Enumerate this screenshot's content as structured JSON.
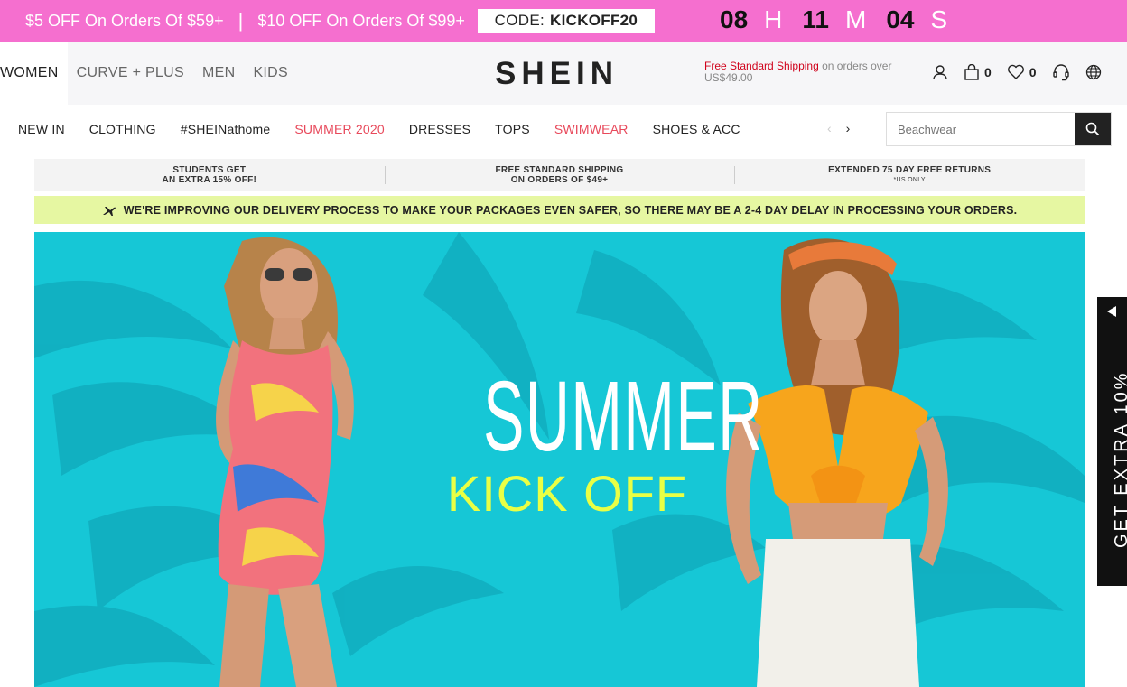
{
  "promo": {
    "offer1": "$5 OFF On Orders Of $59+",
    "separator": "|",
    "offer2": "$10 OFF On Orders Of $99+",
    "code_label": "CODE:",
    "code_value": "KICKOFF20",
    "timer": {
      "hours": "08",
      "hours_unit": "H",
      "minutes": "11",
      "minutes_unit": "M",
      "seconds": "04",
      "seconds_unit": "S"
    },
    "bg_color": "#f56fcf"
  },
  "header": {
    "categories": [
      "WOMEN",
      "CURVE + PLUS",
      "MEN",
      "KIDS"
    ],
    "logo": "SHEIN",
    "shipping_red": "Free Standard Shipping",
    "shipping_rest": " on orders over US$49.00",
    "cart_count": "0",
    "wishlist_count": "0",
    "icons": [
      "user-icon",
      "bag-icon",
      "heart-icon",
      "headset-icon",
      "globe-icon"
    ]
  },
  "nav": {
    "items": [
      "NEW IN",
      "CLOTHING",
      "#SHEINathome",
      "SUMMER 2020",
      "DRESSES",
      "TOPS",
      "SWIMWEAR",
      "SHOES & ACC"
    ],
    "prev_arrow": "‹",
    "next_arrow": "›",
    "search_placeholder": "Beachwear",
    "accent_color": "#e8495b"
  },
  "info": {
    "students_line1": "STUDENTS GET",
    "students_line2": "AN EXTRA 15% OFF!",
    "shipping_line1": "FREE STANDARD SHIPPING",
    "shipping_line2": "ON ORDERS OF $49+",
    "returns_line1": "EXTENDED 75 DAY FREE RETURNS",
    "returns_line2": "*US ONLY"
  },
  "notice": {
    "text": "WE'RE IMPROVING OUR DELIVERY PROCESS TO MAKE YOUR PACKAGES EVEN SAFER, SO THERE MAY BE A 2-4 DAY DELAY IN PROCESSING YOUR ORDERS.",
    "bg_color": "#e6f7a2"
  },
  "hero": {
    "title1": "SUMMER",
    "title2": "KICK OFF",
    "bg_color": "#16c7d6",
    "title2_color": "#e9ff45"
  },
  "sidetab": {
    "text": "GET EXTRA 10%"
  }
}
